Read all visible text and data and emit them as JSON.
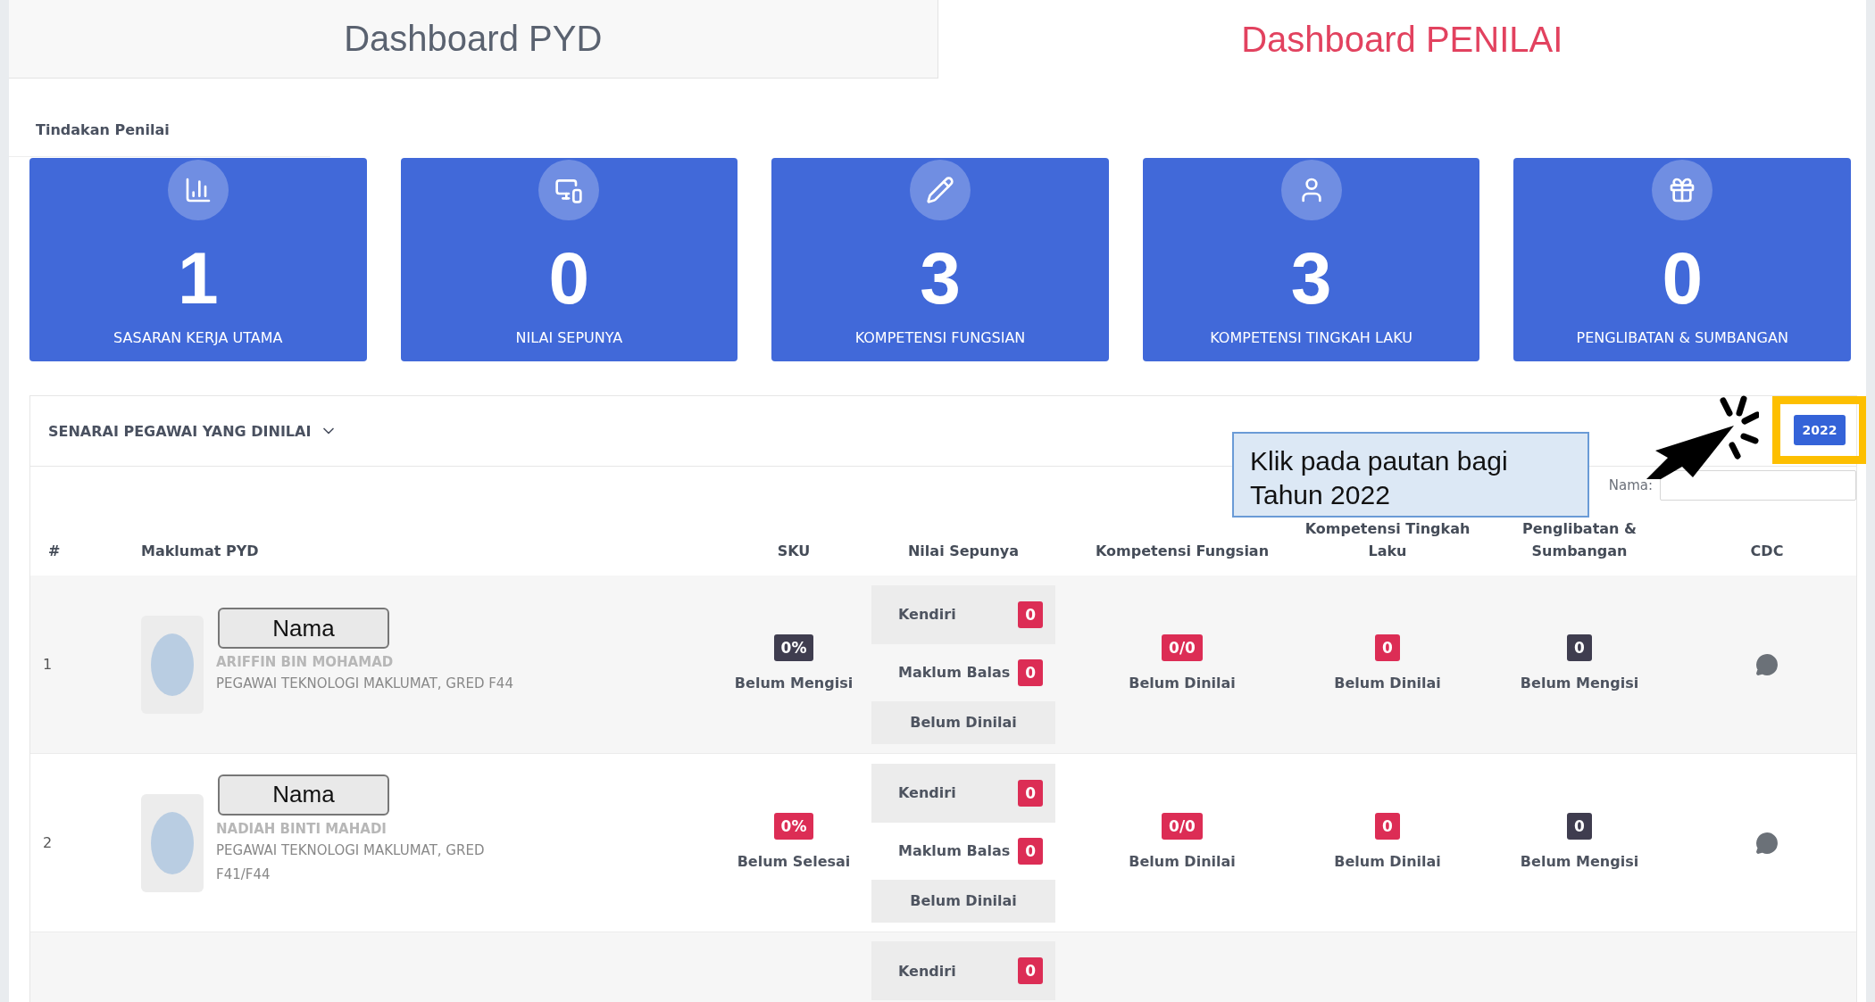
{
  "tabs": [
    {
      "label": "Dashboard PYD",
      "selected": false
    },
    {
      "label": "Dashboard PENILAI",
      "selected": true
    }
  ],
  "section_title": "Tindakan Penilai",
  "stat_cards": [
    {
      "kind": "chart",
      "value": "1",
      "label": "SASARAN KERJA UTAMA"
    },
    {
      "kind": "devices",
      "value": "0",
      "label": "NILAI SEPUNYA"
    },
    {
      "kind": "pencil",
      "value": "3",
      "label": "KOMPETENSI FUNGSIAN"
    },
    {
      "kind": "user",
      "value": "3",
      "label": "KOMPETENSI TINGKAH LAKU"
    },
    {
      "kind": "gift",
      "value": "0",
      "label": "PENGLIBATAN & SUMBANGAN"
    }
  ],
  "panel": {
    "title": "SENARAI PEGAWAI YANG DINILAI",
    "year_button": "2022",
    "search_label": "Nama:"
  },
  "callout": {
    "text": "Klik pada pautan bagi Tahun 2022"
  },
  "table": {
    "columns": [
      "#",
      "Maklumat PYD",
      "SKU",
      "Nilai Sepunya",
      "Kompetensi Fungsian",
      "Kompetensi Tingkah Laku",
      "Penglibatan & Sumbangan",
      "CDC"
    ],
    "rows": [
      {
        "index": "1",
        "name_tag": "Nama",
        "name": "ARIFFIN BIN MOHAMAD",
        "position": "PEGAWAI TEKNOLOGI MAKLUMAT, GRED F44",
        "sku": {
          "value": "0%",
          "status": "Belum Mengisi",
          "color": "#3f3d4f"
        },
        "nilai": {
          "kendiri": {
            "label": "Kendiri",
            "value": "0"
          },
          "maklum_balas": {
            "label": "Maklum Balas",
            "value": "0"
          },
          "status": "Belum Dinilai"
        },
        "scores": [
          {
            "value": "0/0",
            "status": "Belum Dinilai",
            "color": "#dc2d55"
          },
          {
            "value": "0",
            "status": "Belum Dinilai",
            "color": "#dc2d55"
          },
          {
            "value": "0",
            "status": "Belum Mengisi",
            "color": "#3f3d4f"
          }
        ]
      },
      {
        "index": "2",
        "name_tag": "Nama",
        "name": "NADIAH BINTI MAHADI",
        "position": "PEGAWAI TEKNOLOGI MAKLUMAT, GRED F41/F44",
        "sku": {
          "value": "0%",
          "status": "Belum Selesai",
          "color": "#dc2d55"
        },
        "nilai": {
          "kendiri": {
            "label": "Kendiri",
            "value": "0"
          },
          "maklum_balas": {
            "label": "Maklum Balas",
            "value": "0"
          },
          "status": "Belum Dinilai"
        },
        "scores": [
          {
            "value": "0/0",
            "status": "Belum Dinilai",
            "color": "#dc2d55"
          },
          {
            "value": "0",
            "status": "Belum Dinilai",
            "color": "#dc2d55"
          },
          {
            "value": "0",
            "status": "Belum Mengisi",
            "color": "#3f3d4f"
          }
        ]
      },
      {
        "nilai": {
          "kendiri": {
            "label": "Kendiri",
            "value": "0"
          }
        }
      }
    ]
  }
}
